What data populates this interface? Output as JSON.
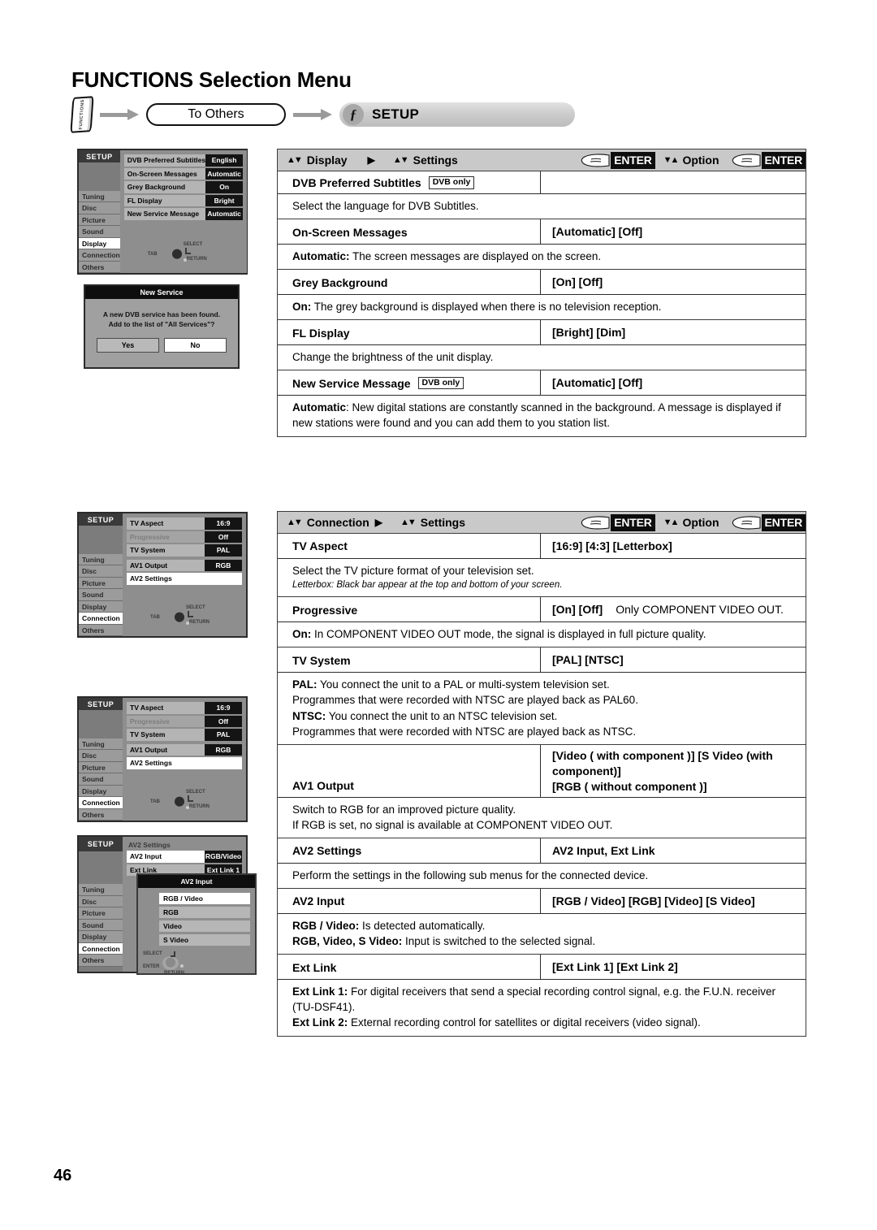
{
  "page": {
    "title": "FUNCTIONS Selection Menu",
    "number": "46"
  },
  "breadcrumb": {
    "function_key_label": "FUNCTIONS",
    "to_others_label": "To Others",
    "setup_label": "SETUP",
    "setup_badge_glyph": "ƒ"
  },
  "osd_panels": [
    {
      "name": "display-panel",
      "title": "SETUP",
      "nav_items": [
        "Tuning",
        "Disc",
        "Picture",
        "Sound",
        "Display",
        "Connection",
        "Others"
      ],
      "nav_selected": "Display",
      "rows": [
        {
          "label": "DVB Preferred Subtitles",
          "value": "English"
        },
        {
          "label": "On-Screen Messages",
          "value": "Automatic"
        },
        {
          "label": "Grey Background",
          "value": "On"
        },
        {
          "label": "FL Display",
          "value": "Bright"
        },
        {
          "label": "New Service Message",
          "value": "Automatic"
        }
      ],
      "pad": {
        "tab": "TAB",
        "select": "SELECT",
        "return": "RETURN"
      }
    },
    {
      "name": "connection-panel-1",
      "title": "SETUP",
      "nav_items": [
        "Tuning",
        "Disc",
        "Picture",
        "Sound",
        "Display",
        "Connection",
        "Others"
      ],
      "nav_selected": "Connection",
      "rows": [
        {
          "label": "TV Aspect",
          "value": "16:9"
        },
        {
          "label": "Progressive",
          "value": "Off",
          "dim": true
        },
        {
          "label": "TV System",
          "value": "PAL"
        },
        {
          "label": "AV1 Output",
          "value": "RGB"
        },
        {
          "label": "AV2 Settings",
          "value": ""
        }
      ],
      "pad": {
        "tab": "TAB",
        "select": "SELECT",
        "return": "RETURN"
      }
    },
    {
      "name": "connection-panel-2",
      "title": "SETUP",
      "nav_items": [
        "Tuning",
        "Disc",
        "Picture",
        "Sound",
        "Display",
        "Connection",
        "Others"
      ],
      "nav_selected": "Connection",
      "rows": [
        {
          "label": "TV Aspect",
          "value": "16:9"
        },
        {
          "label": "Progressive",
          "value": "Off",
          "dim": true
        },
        {
          "label": "TV System",
          "value": "PAL"
        },
        {
          "label": "AV1 Output",
          "value": "RGB"
        },
        {
          "label": "AV2 Settings",
          "value": ""
        }
      ],
      "pad": {
        "tab": "TAB",
        "select": "SELECT",
        "return": "RETURN"
      }
    },
    {
      "name": "av2-settings-panel",
      "title": "SETUP",
      "heading": "AV2 Settings",
      "nav_items": [
        "Tuning",
        "Disc",
        "Picture",
        "Sound",
        "Display",
        "Connection",
        "Others"
      ],
      "nav_selected": "Connection",
      "rows": [
        {
          "label": "AV2 Input",
          "value": "RGB/Video"
        },
        {
          "label": "Ext Link",
          "value": "Ext Link 1"
        }
      ],
      "pad": {
        "select": "SELECT",
        "enter": "ENTER",
        "return": "RETURN"
      }
    }
  ],
  "new_service_dialog": {
    "title": "New Service",
    "line1": "A new DVB service has been found.",
    "line2": "Add to the list of \"All Services\"?",
    "yes_label": "Yes",
    "no_label": "No"
  },
  "av2_input_popup": {
    "title": "AV2 Input",
    "items": [
      "RGB / Video",
      "RGB",
      "Video",
      "S Video"
    ],
    "selected": "RGB / Video"
  },
  "tables": [
    {
      "name": "display-settings-table",
      "header": {
        "col1": "Display",
        "col2": "Settings",
        "enter1": "ENTER",
        "option": "Option",
        "enter2": "ENTER"
      },
      "rows": [
        {
          "label": "DVB Preferred Subtitles",
          "badge": "DVB only",
          "options": "",
          "desc_plain": "Select the language for DVB Subtitles."
        },
        {
          "label": "On-Screen Messages",
          "badge": "",
          "options": "[Automatic] [Off]",
          "desc_bold": "Automatic:",
          "desc_plain": " The screen messages are displayed on the screen."
        },
        {
          "label": "Grey Background",
          "badge": "",
          "options": "[On] [Off]",
          "desc_bold": "On:",
          "desc_plain": " The grey background is displayed when there is no television reception."
        },
        {
          "label": "FL Display",
          "badge": "",
          "options": "[Bright] [Dim]",
          "desc_plain": "Change the brightness of the unit display."
        },
        {
          "label": "New Service Message",
          "badge": "DVB only",
          "options": "[Automatic] [Off]",
          "desc_bold": "Automatic",
          "desc_plain": ": New digital stations are constantly scanned in the background. A message is displayed if new stations were found and you can add them to you station list."
        }
      ]
    },
    {
      "name": "connection-settings-table",
      "header": {
        "col1": "Connection",
        "col2": "Settings",
        "enter1": "ENTER",
        "option": "Option",
        "enter2": "ENTER"
      },
      "rows": [
        {
          "label": "TV Aspect",
          "options": "[16:9] [4:3] [Letterbox]",
          "desc_plain": "Select the TV picture format of your television set.",
          "desc_italic": "Letterbox: Black bar appear at the top and bottom of your screen."
        },
        {
          "label": "Progressive",
          "options": "[On] [Off]",
          "options_note": "Only COMPONENT VIDEO OUT.",
          "desc_bold": "On:",
          "desc_plain": " In COMPONENT VIDEO OUT mode, the signal is displayed in full picture quality."
        },
        {
          "label": "TV System",
          "options": "[PAL] [NTSC]",
          "desc_lines": [
            {
              "bold": "PAL:",
              "text": " You connect the unit to a PAL or multi-system television set."
            },
            {
              "bold": "",
              "text": "Programmes that were recorded with NTSC are played back as PAL60."
            },
            {
              "bold": "NTSC:",
              "text": " You connect the unit to an NTSC television set."
            },
            {
              "bold": "",
              "text": "Programmes that were recorded with NTSC are played back as NTSC."
            }
          ]
        },
        {
          "label": "AV1 Output",
          "options_line1": "[Video ( with component )] [S Video (with component)]",
          "options_line2": "[RGB ( without component )]",
          "desc_lines": [
            {
              "bold": "",
              "text": "Switch to RGB for an improved picture quality."
            },
            {
              "bold": "",
              "text": "If RGB is set, no signal is available at COMPONENT VIDEO OUT."
            }
          ]
        },
        {
          "label": "AV2 Settings",
          "options": "AV2 Input, Ext Link",
          "desc_plain": "Perform the settings in the following sub menus for the connected device."
        },
        {
          "label": "AV2 Input",
          "options": "[RGB / Video] [RGB] [Video] [S Video]",
          "desc_lines": [
            {
              "bold": "RGB / Video:",
              "text": " Is detected automatically."
            },
            {
              "bold": "RGB, Video, S Video:",
              "text": " Input is switched to the selected signal."
            }
          ]
        },
        {
          "label": "Ext Link",
          "options": "[Ext Link 1] [Ext Link 2]",
          "desc_lines": [
            {
              "bold": "Ext Link 1:",
              "text": " For digital receivers that send a special recording control signal, e.g. the F.U.N. receiver (TU-DSF41)."
            },
            {
              "bold": "Ext Link 2:",
              "text": " External recording control for satellites or digital receivers (video signal)."
            }
          ]
        }
      ]
    }
  ]
}
